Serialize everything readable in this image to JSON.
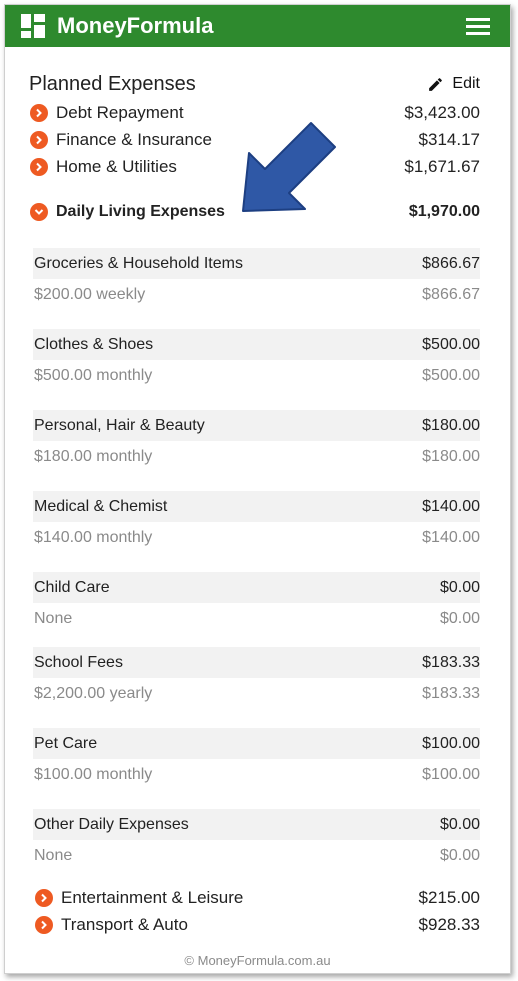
{
  "app": {
    "title": "MoneyFormula",
    "logo_icon": "dashboard-icon",
    "menu_icon": "hamburger-menu-icon"
  },
  "section": {
    "title": "Planned Expenses",
    "edit_label": "Edit",
    "edit_icon": "pencil-icon"
  },
  "categories_top": [
    {
      "label": "Debt Repayment",
      "amount": "$3,423.00"
    },
    {
      "label": "Finance & Insurance",
      "amount": "$314.17"
    },
    {
      "label": "Home & Utilities",
      "amount": "$1,671.67"
    }
  ],
  "expanded_category": {
    "label": "Daily Living Expenses",
    "amount": "$1,970.00"
  },
  "items": [
    {
      "name": "Groceries & Household Items",
      "amount": "$866.67",
      "frequency": "$200.00 weekly",
      "sub_amount": "$866.67"
    },
    {
      "name": "Clothes & Shoes",
      "amount": "$500.00",
      "frequency": "$500.00 monthly",
      "sub_amount": "$500.00"
    },
    {
      "name": "Personal, Hair & Beauty",
      "amount": "$180.00",
      "frequency": "$180.00 monthly",
      "sub_amount": "$180.00"
    },
    {
      "name": "Medical & Chemist",
      "amount": "$140.00",
      "frequency": "$140.00 monthly",
      "sub_amount": "$140.00"
    },
    {
      "name": "Child Care",
      "amount": "$0.00",
      "frequency": "None",
      "sub_amount": "$0.00"
    },
    {
      "name": "School Fees",
      "amount": "$183.33",
      "frequency": "$2,200.00 yearly",
      "sub_amount": "$183.33"
    },
    {
      "name": "Pet Care",
      "amount": "$100.00",
      "frequency": "$100.00 monthly",
      "sub_amount": "$100.00"
    },
    {
      "name": "Other Daily Expenses",
      "amount": "$0.00",
      "frequency": "None",
      "sub_amount": "$0.00"
    }
  ],
  "categories_bottom": [
    {
      "label": "Entertainment & Leisure",
      "amount": "$215.00"
    },
    {
      "label": "Transport & Auto",
      "amount": "$928.33"
    }
  ],
  "footer": {
    "text": "© MoneyFormula.com.au"
  },
  "colors": {
    "header": "#2e8a2e",
    "accent": "#ee5a22",
    "arrow": "#2f58a6"
  }
}
